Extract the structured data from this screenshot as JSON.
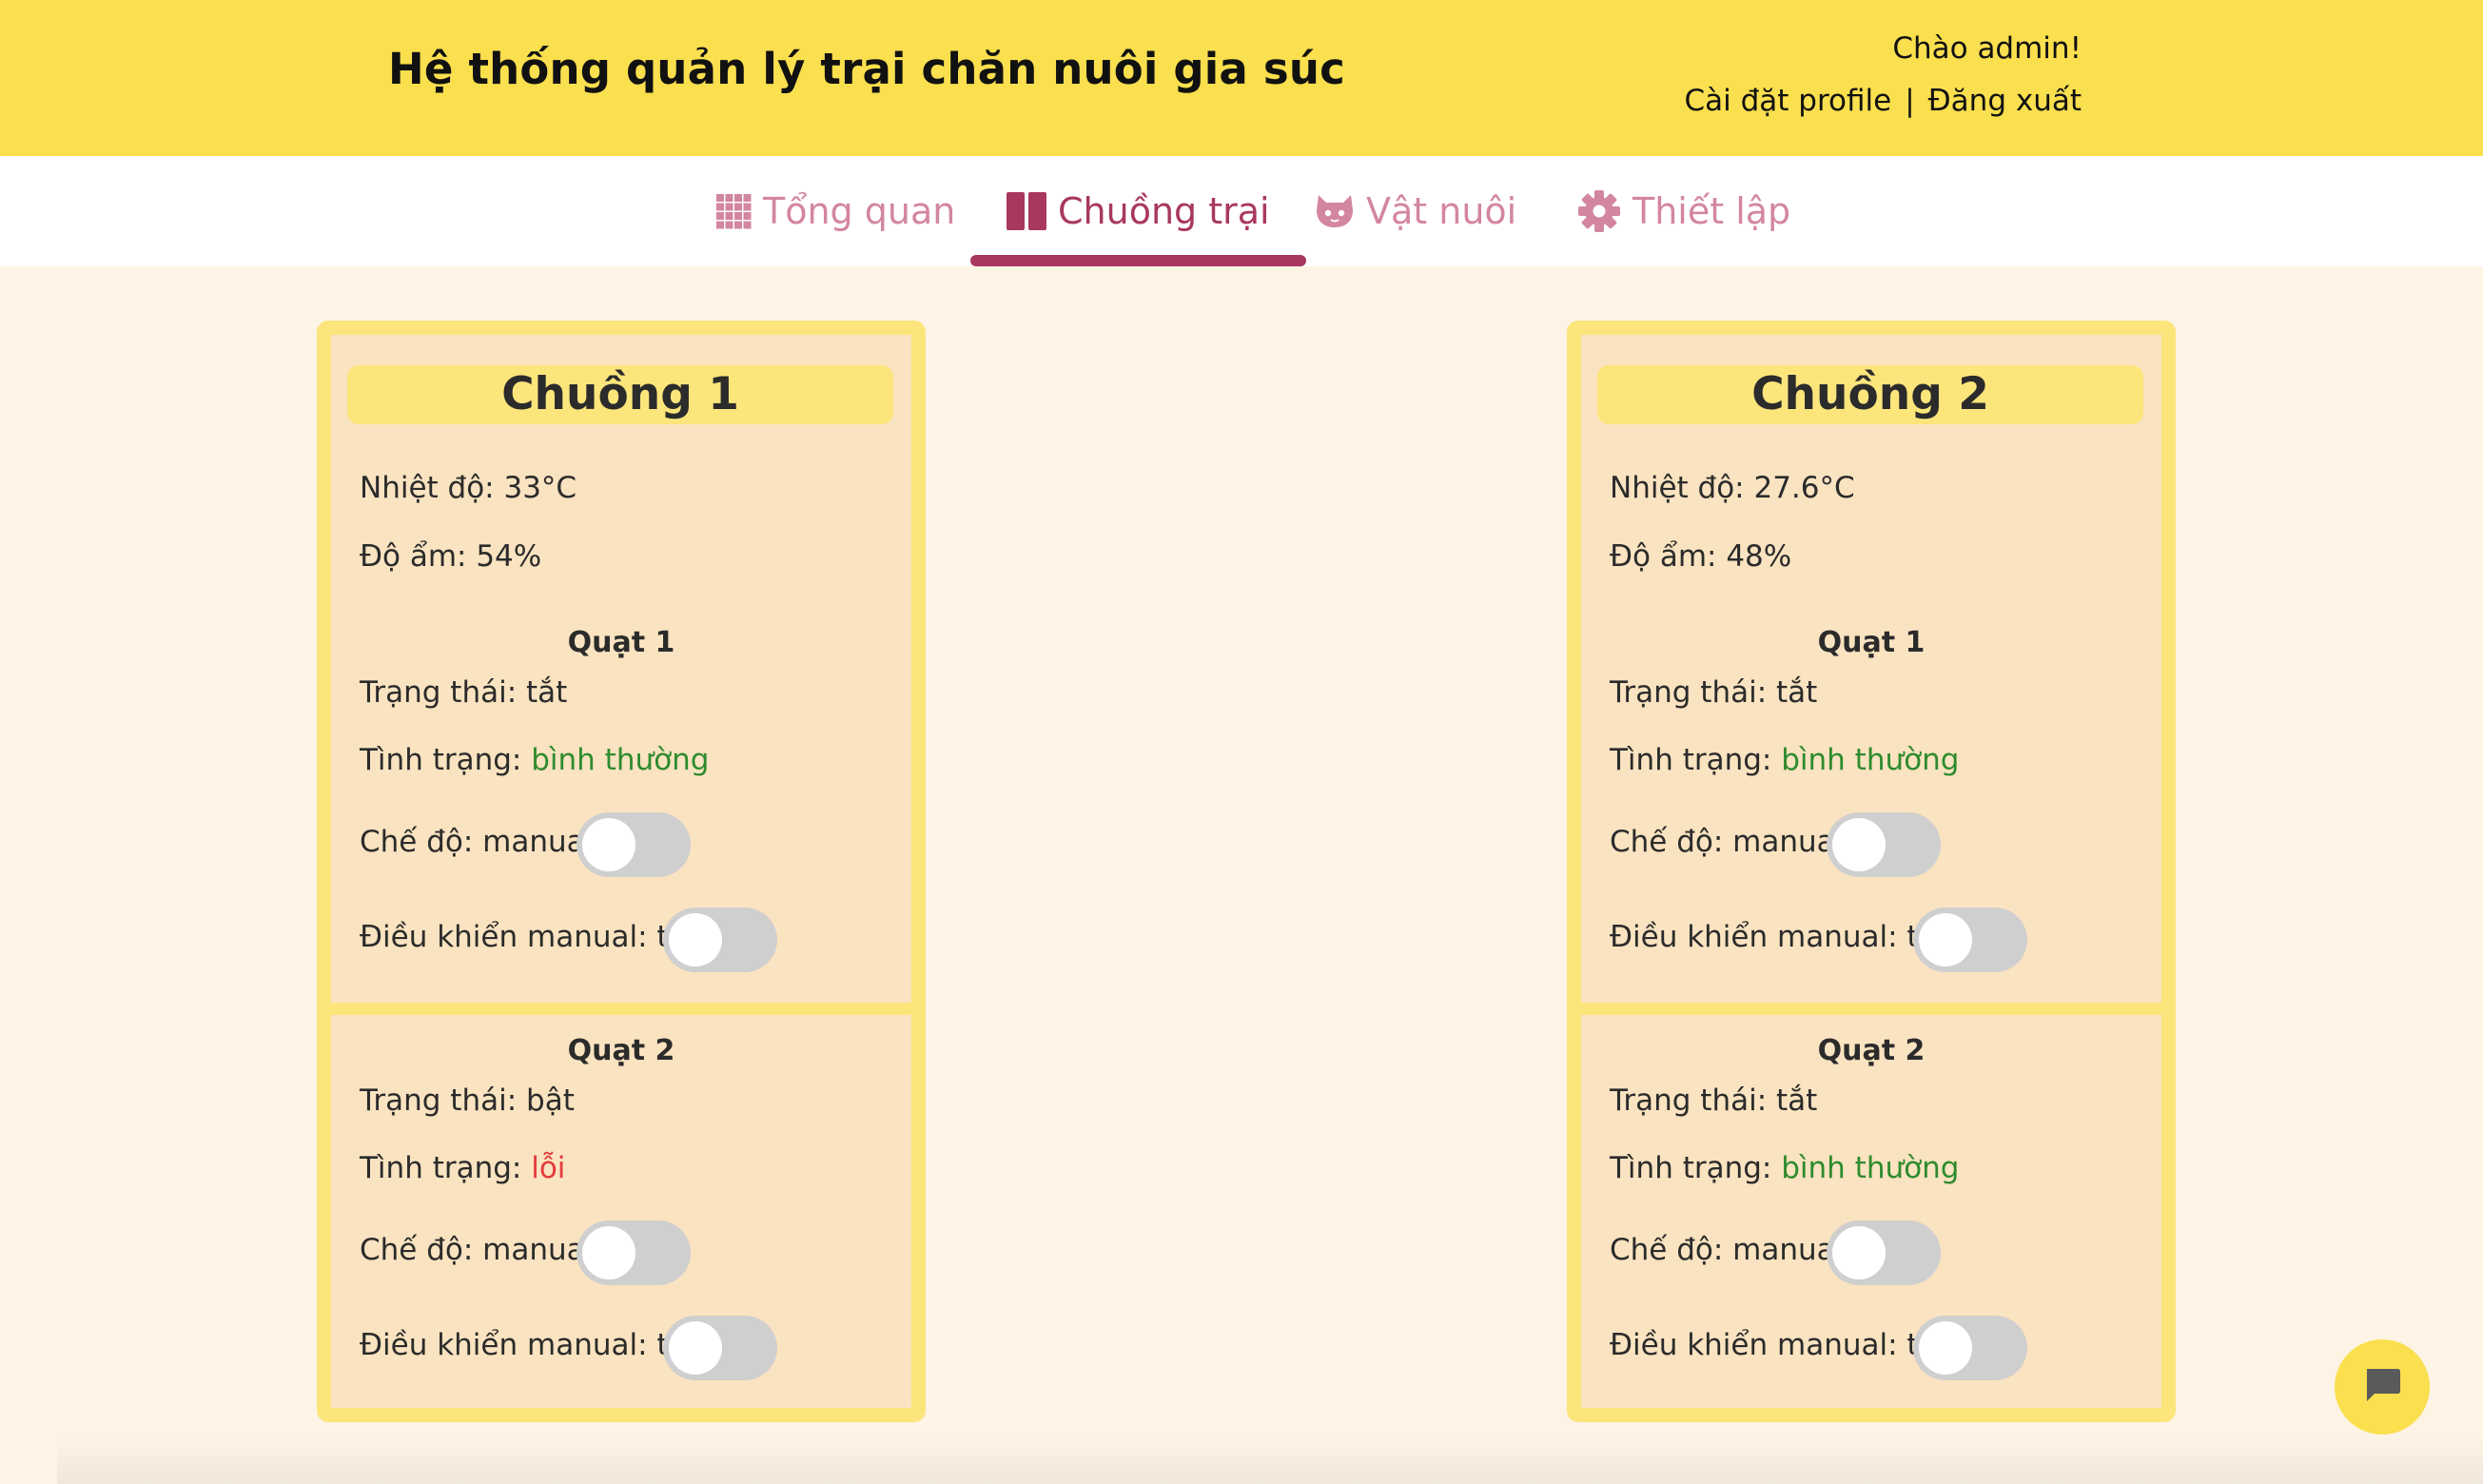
{
  "header": {
    "title": "Hệ thống quản lý trại chăn nuôi gia súc",
    "greeting": "Chào admin!",
    "profile_link": "Cài đặt profile",
    "separator": "|",
    "logout_link": "Đăng xuất"
  },
  "tabs": [
    {
      "label": "Tổng quan",
      "icon": "grid-icon",
      "active": false
    },
    {
      "label": "Chuồng trại",
      "icon": "book-icon",
      "active": true
    },
    {
      "label": "Vật nuôi",
      "icon": "cat-icon",
      "active": false
    },
    {
      "label": "Thiết lập",
      "icon": "gear-icon",
      "active": false
    }
  ],
  "barns": [
    {
      "name": "Chuồng 1",
      "temperature": "Nhiệt độ: 33°C",
      "humidity": "Độ ẩm: 54%",
      "fans": [
        {
          "title": "Quạt 1",
          "state_label": "Trạng thái: ",
          "state_value": "tắt",
          "condition_label": "Tình trạng: ",
          "condition_value": "bình thường",
          "condition_status": "ok",
          "mode_label": "Chế độ: manual",
          "mode_on": false,
          "manual_label": "Điều khiển manual: tắt",
          "manual_on": false
        },
        {
          "title": "Quạt 2",
          "state_label": "Trạng thái: ",
          "state_value": "bật",
          "condition_label": "Tình trạng: ",
          "condition_value": "lỗi",
          "condition_status": "error",
          "mode_label": "Chế độ: manual",
          "mode_on": false,
          "manual_label": "Điều khiển manual: tắt",
          "manual_on": false
        }
      ]
    },
    {
      "name": "Chuồng 2",
      "temperature": "Nhiệt độ: 27.6°C",
      "humidity": "Độ ẩm: 48%",
      "fans": [
        {
          "title": "Quạt 1",
          "state_label": "Trạng thái: ",
          "state_value": "tắt",
          "condition_label": "Tình trạng: ",
          "condition_value": "bình thường",
          "condition_status": "ok",
          "mode_label": "Chế độ: manual",
          "mode_on": false,
          "manual_label": "Điều khiển manual: tắt",
          "manual_on": false
        },
        {
          "title": "Quạt 2",
          "state_label": "Trạng thái: ",
          "state_value": "tắt",
          "condition_label": "Tình trạng: ",
          "condition_value": "bình thường",
          "condition_status": "ok",
          "mode_label": "Chế độ: manual",
          "mode_on": false,
          "manual_label": "Điều khiển manual: tắt",
          "manual_on": false
        }
      ]
    }
  ],
  "colors": {
    "header_bg": "#fadf4e",
    "tab_active": "#a8385f",
    "tab_inactive": "#d3869f",
    "card_border": "#fce57b",
    "card_bg": "#fae3c0",
    "status_ok": "#2e8b2e",
    "status_error": "#e23b3b"
  },
  "chat_button": {
    "icon": "chat-bubble-icon"
  }
}
